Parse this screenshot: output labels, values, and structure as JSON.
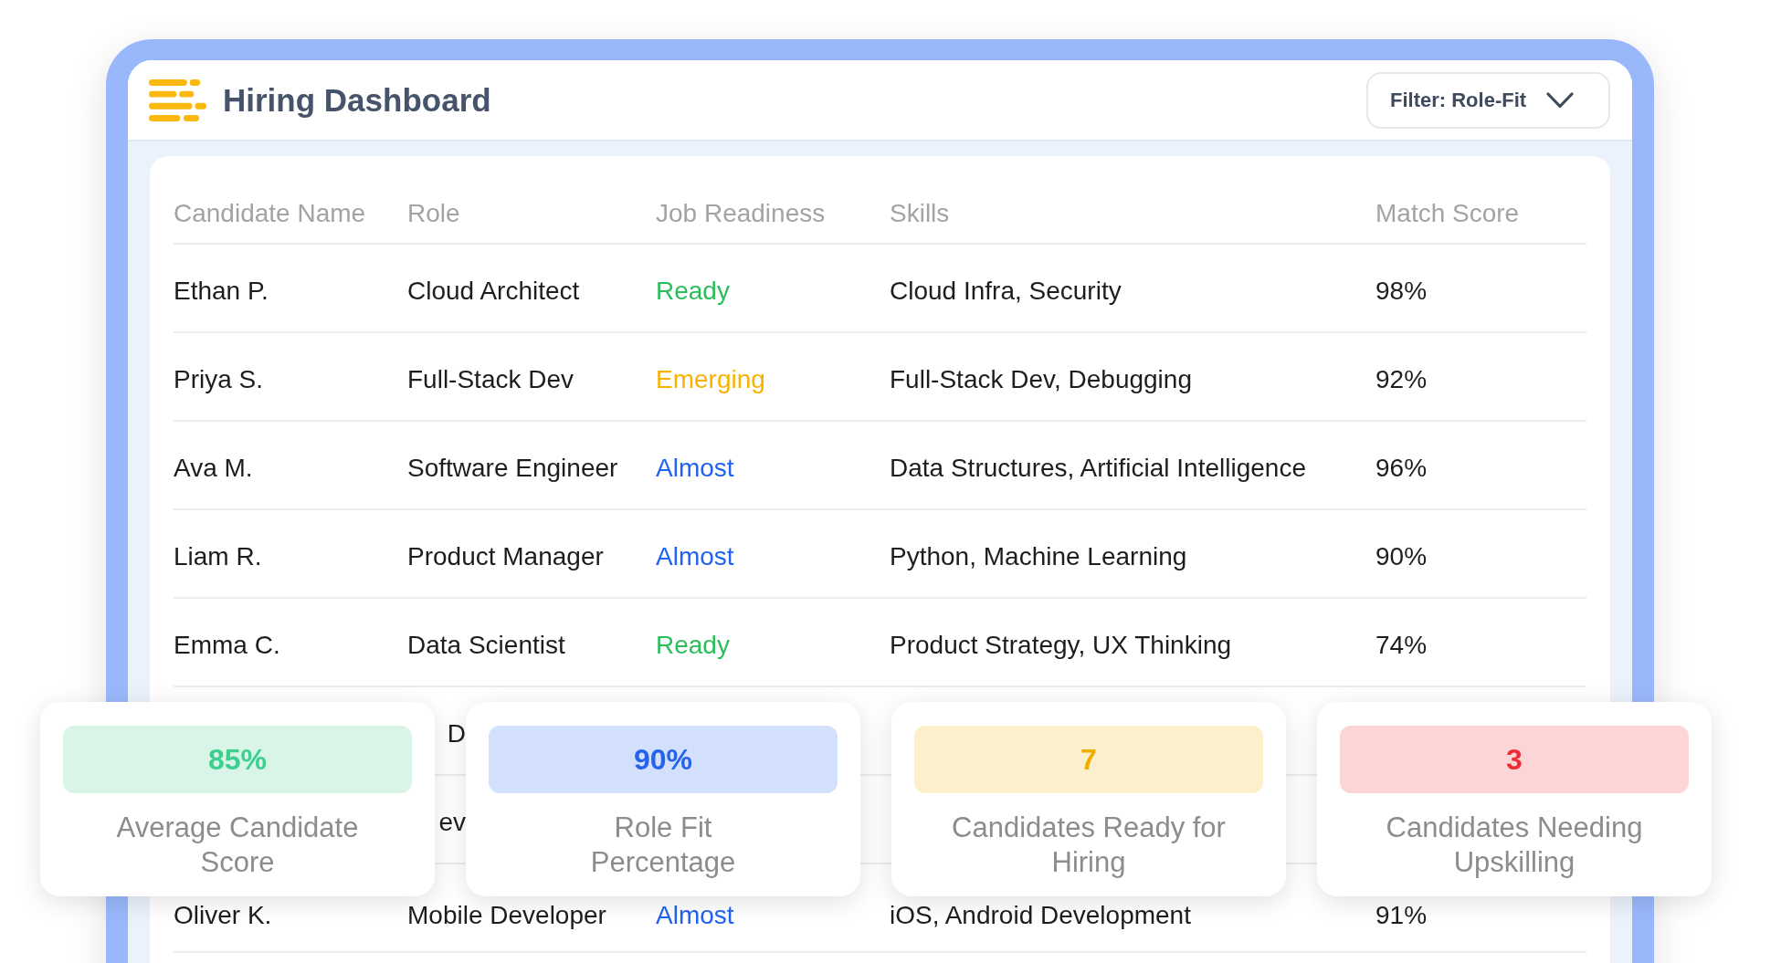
{
  "header": {
    "title": "Hiring Dashboard",
    "filter": "Filter: Role-Fit"
  },
  "table": {
    "columns": [
      "Candidate Name",
      "Role",
      "Job Readiness",
      "Skills",
      "Match Score"
    ],
    "rows": [
      {
        "kind": "full",
        "name": "Ethan P.",
        "role": "Cloud Architect",
        "readiness": {
          "label": "Ready",
          "color": "#2bbf5b"
        },
        "skills": "Cloud Infra, Security",
        "score": "98%"
      },
      {
        "kind": "full",
        "name": "Priya S.",
        "role": "Full-Stack Dev",
        "readiness": {
          "label": "Emerging",
          "color": "#f6b300"
        },
        "skills": "Full-Stack Dev, Debugging",
        "score": "92%"
      },
      {
        "kind": "full",
        "name": "Ava M.",
        "role": "Software Engineer",
        "readiness": {
          "label": "Almost",
          "color": "#1f63f0"
        },
        "skills": "Data Structures, Artificial Intelligence",
        "score": "96%"
      },
      {
        "kind": "full",
        "name": "Liam R.",
        "role": "Product Manager",
        "readiness": {
          "label": "Almost",
          "color": "#1f63f0"
        },
        "skills": "Python, Machine Learning",
        "score": "90%"
      },
      {
        "kind": "full",
        "name": "Emma C.",
        "role": "Data Scientist",
        "readiness": {
          "label": "Ready",
          "color": "#2bbf5b"
        },
        "skills": "Product Strategy, UX Thinking",
        "score": "74%"
      },
      {
        "kind": "partial",
        "role": "D"
      },
      {
        "kind": "partial",
        "role": "ev"
      },
      {
        "kind": "full",
        "name": "Oliver K.",
        "role": "Mobile Developer",
        "readiness": {
          "label": "Almost",
          "color": "#1f63f0"
        },
        "skills": "iOS, Android Development",
        "score": "91%"
      }
    ]
  },
  "stats": [
    {
      "value": "85%",
      "label": "Average Candidate\nScore",
      "color": "#3ccf8e"
    },
    {
      "value": "90%",
      "label": "Role Fit\nPercentage",
      "color": "#2563eb"
    },
    {
      "value": "7",
      "label": "Candidates Ready for\nHiring",
      "color": "#f0ad00"
    },
    {
      "value": "3",
      "label": "Candidates Needing\nUpskilling",
      "color": "#ee2b36"
    }
  ]
}
